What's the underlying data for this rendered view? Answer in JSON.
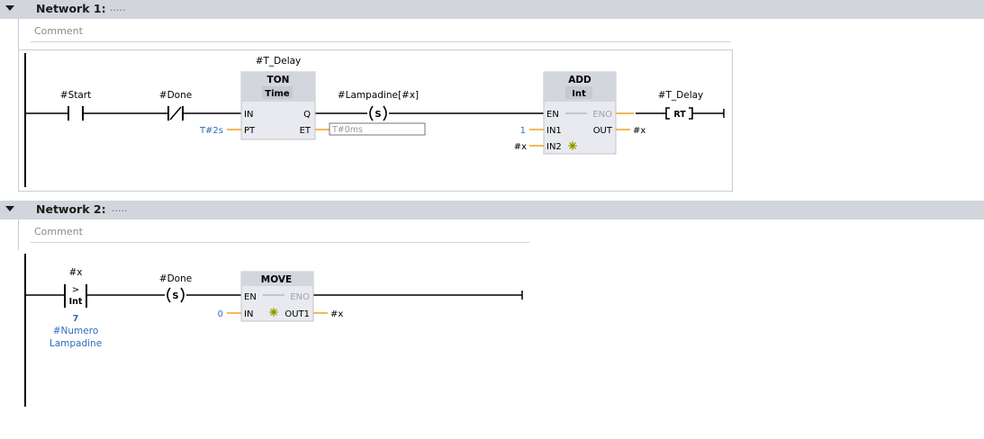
{
  "networks": [
    {
      "title": "Network 1:",
      "title_dots": ".....",
      "comment": "Comment",
      "contacts": [
        {
          "operand": "#Start",
          "type": "normally-open"
        },
        {
          "operand": "#Done",
          "type": "normally-closed"
        }
      ],
      "timer": {
        "instance": "#T_Delay",
        "type": "TON",
        "datatype": "Time",
        "pin_in": "IN",
        "pin_pt": "PT",
        "pin_q": "Q",
        "pin_et": "ET",
        "pt_value": "T#2s",
        "et_value": "T#0ms"
      },
      "set_coil": {
        "operand": "#Lampadine[#x]",
        "symbol": "S"
      },
      "add_block": {
        "name": "ADD",
        "datatype": "Int",
        "pin_en": "EN",
        "pin_eno": "ENO",
        "pin_in1": "IN1",
        "pin_in2": "IN2",
        "pin_out": "OUT",
        "in1_value": "1",
        "in2_value": "#x",
        "out_value": "#x"
      },
      "reset_timer_coil": {
        "operand": "#T_Delay",
        "symbol": "RT"
      }
    },
    {
      "title": "Network 2:",
      "title_dots": ".....",
      "comment": "Comment",
      "compare": {
        "operand": "#x",
        "operator": ">",
        "datatype": "Int",
        "value": "7",
        "ref_line1": "#Numero",
        "ref_line2": "Lampadine"
      },
      "set_coil": {
        "operand": "#Done",
        "symbol": "S"
      },
      "move_block": {
        "name": "MOVE",
        "pin_en": "EN",
        "pin_eno": "ENO",
        "pin_in": "IN",
        "pin_out1": "OUT1",
        "in_value": "0",
        "out1_value": "#x"
      }
    }
  ],
  "colors": {
    "wire": "#000000",
    "param_wire": "#f0a020",
    "const_text": "#2a6fbf",
    "header_bg": "#d2d6dc",
    "box_fill": "#e8eaef",
    "box_header": "#d3d6dd",
    "star": "#c8d400"
  }
}
